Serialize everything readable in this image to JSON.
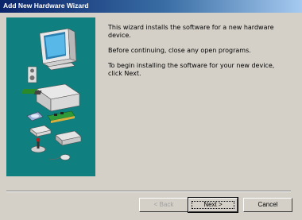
{
  "window": {
    "title": "Add New Hardware Wizard"
  },
  "body": {
    "paragraphs": [
      "This wizard installs the software for a new hardware device.",
      "Before continuing, close any open programs.",
      "To begin installing the software for your new device, click Next."
    ]
  },
  "buttons": {
    "back_label": "< Back",
    "next_label": "Next >",
    "cancel_label": "Cancel"
  },
  "colors": {
    "panel": "#0f7f7f",
    "titlebar": "#0a246a",
    "face": "#d4d0c8"
  },
  "icons": [
    "monitor-icon",
    "speaker-icon",
    "pc-case-icon",
    "cd-rom-icon",
    "expansion-card-icon",
    "modem-icon",
    "joystick-icon",
    "drive-icon"
  ]
}
